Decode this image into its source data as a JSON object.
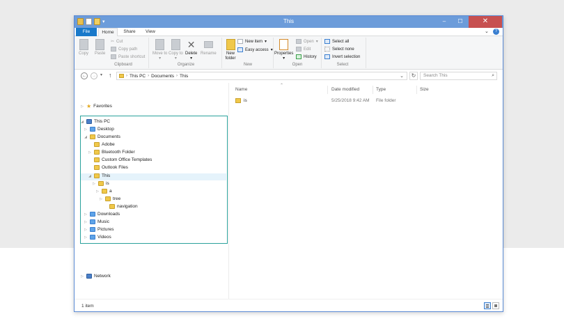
{
  "window": {
    "title": "This",
    "min_glyph": "–",
    "max_glyph": "☐",
    "close_glyph": "✕"
  },
  "ribbon_tabs": [
    "File",
    "Home",
    "Share",
    "View"
  ],
  "ribbon": {
    "clipboard": {
      "label": "Clipboard",
      "copy": "Copy",
      "paste": "Paste",
      "cut": "Cut",
      "copy_path": "Copy path",
      "paste_shortcut": "Paste shortcut"
    },
    "organize": {
      "label": "Organize",
      "move_to": "Move to",
      "copy_to": "Copy to",
      "delete": "Delete",
      "rename": "Rename"
    },
    "new": {
      "label": "New",
      "new_folder": "New folder",
      "new_item": "New item",
      "easy_access": "Easy access"
    },
    "open": {
      "label": "Open",
      "properties": "Properties",
      "open": "Open",
      "edit": "Edit",
      "history": "History"
    },
    "select": {
      "label": "Select",
      "select_all": "Select all",
      "select_none": "Select none",
      "invert_selection": "Invert selection"
    }
  },
  "address": {
    "crumbs": [
      "This PC",
      "Documents",
      "This"
    ],
    "search_placeholder": "Search This"
  },
  "nav_tree": {
    "favorites": "Favorites",
    "this_pc": "This PC",
    "desktop": "Desktop",
    "documents": "Documents",
    "adobe": "Adobe",
    "bluetooth": "Bluetooth Folder",
    "custom_office": "Custom Office Templates",
    "outlook": "Outlook Files",
    "this": "This",
    "is": "is",
    "a": "a",
    "tree": "tree",
    "navigation": "navigation",
    "downloads": "Downloads",
    "music": "Music",
    "pictures": "Pictures",
    "videos": "Videos",
    "network": "Network"
  },
  "columns": {
    "name": "Name",
    "date_modified": "Date modified",
    "type": "Type",
    "size": "Size"
  },
  "files": [
    {
      "name": "is",
      "date": "5/25/2018 9:42 AM",
      "type": "File folder",
      "size": ""
    }
  ],
  "status": {
    "item_count": "1 item"
  },
  "colors": {
    "titlebar": "#6c9cda",
    "file_tab": "#1979ca",
    "close_button": "#c75050",
    "highlight_box": "#2aa19b",
    "folder": "#f0c84a"
  }
}
